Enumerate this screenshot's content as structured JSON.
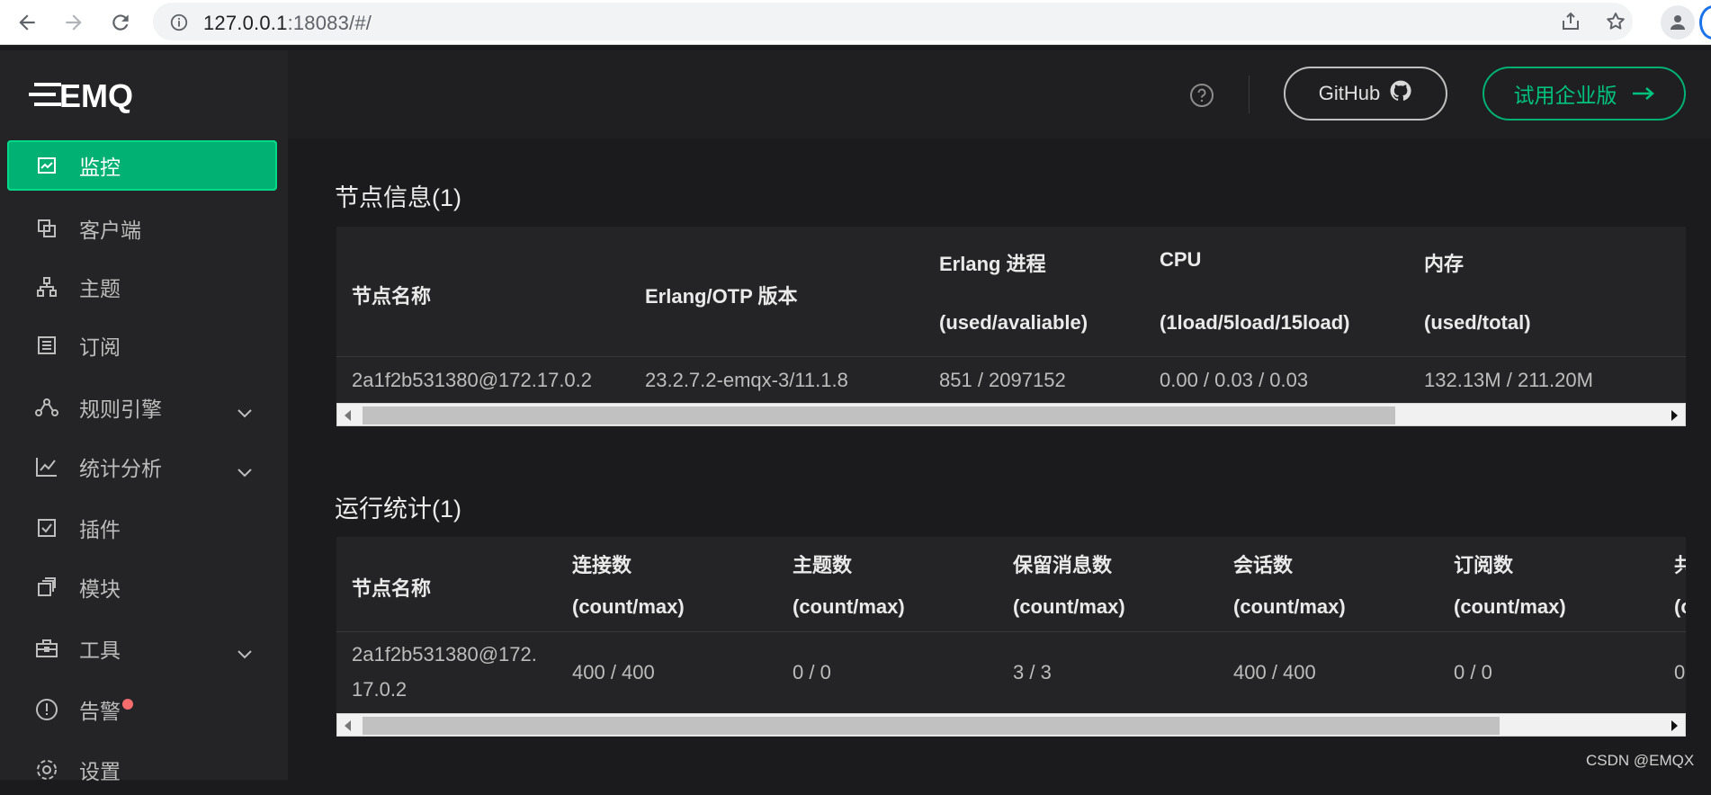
{
  "browser": {
    "url_host": "127.0.0.1",
    "url_rest": ":18083/#/"
  },
  "sidebar": {
    "logo_text": "EMQ",
    "items": [
      {
        "label": "监控",
        "icon": "monitor-icon",
        "active": true
      },
      {
        "label": "客户端",
        "icon": "clients-icon"
      },
      {
        "label": "主题",
        "icon": "topics-icon"
      },
      {
        "label": "订阅",
        "icon": "subscriptions-icon"
      },
      {
        "label": "规则引擎",
        "icon": "rule-engine-icon",
        "expandable": true
      },
      {
        "label": "统计分析",
        "icon": "analytics-icon",
        "expandable": true
      },
      {
        "label": "插件",
        "icon": "plugins-icon"
      },
      {
        "label": "模块",
        "icon": "modules-icon"
      },
      {
        "label": "工具",
        "icon": "tools-icon",
        "expandable": true
      },
      {
        "label": "告警",
        "icon": "alarm-icon",
        "badge": true
      },
      {
        "label": "设置",
        "icon": "settings-icon"
      }
    ]
  },
  "header": {
    "github_label": "GitHub",
    "trial_label": "试用企业版"
  },
  "node_info": {
    "title": "节点信息(1)",
    "columns": [
      {
        "title": "节点名称",
        "sub": ""
      },
      {
        "title": "Erlang/OTP 版本",
        "sub": ""
      },
      {
        "title": "Erlang 进程",
        "sub": "(used/avaliable)"
      },
      {
        "title": "CPU",
        "sub": "(1load/5load/15load)"
      },
      {
        "title": "内存",
        "sub": "(used/total)"
      }
    ],
    "rows": [
      [
        "2a1f2b531380@172.17.0.2",
        "23.2.7.2-emqx-3/11.1.8",
        "851 / 2097152",
        "0.00 / 0.03 / 0.03",
        "132.13M / 211.20M"
      ]
    ]
  },
  "run_stats": {
    "title": "运行统计(1)",
    "columns": [
      {
        "title": "节点名称",
        "sub": ""
      },
      {
        "title": "连接数",
        "sub": "(count/max)"
      },
      {
        "title": "主题数",
        "sub": "(count/max)"
      },
      {
        "title": "保留消息数",
        "sub": "(count/max)"
      },
      {
        "title": "会话数",
        "sub": "(count/max)"
      },
      {
        "title": "订阅数",
        "sub": "(count/max)"
      },
      {
        "title": "共",
        "sub": "(c"
      }
    ],
    "rows": [
      [
        "2a1f2b531380@172.",
        "17.0.2",
        "400 / 400",
        "0 / 0",
        "3 / 3",
        "400 / 400",
        "0 / 0",
        "0"
      ]
    ]
  },
  "watermark": "CSDN @EMQX",
  "colors": {
    "accent": "#00b173",
    "alarm": "#f56c6c"
  }
}
